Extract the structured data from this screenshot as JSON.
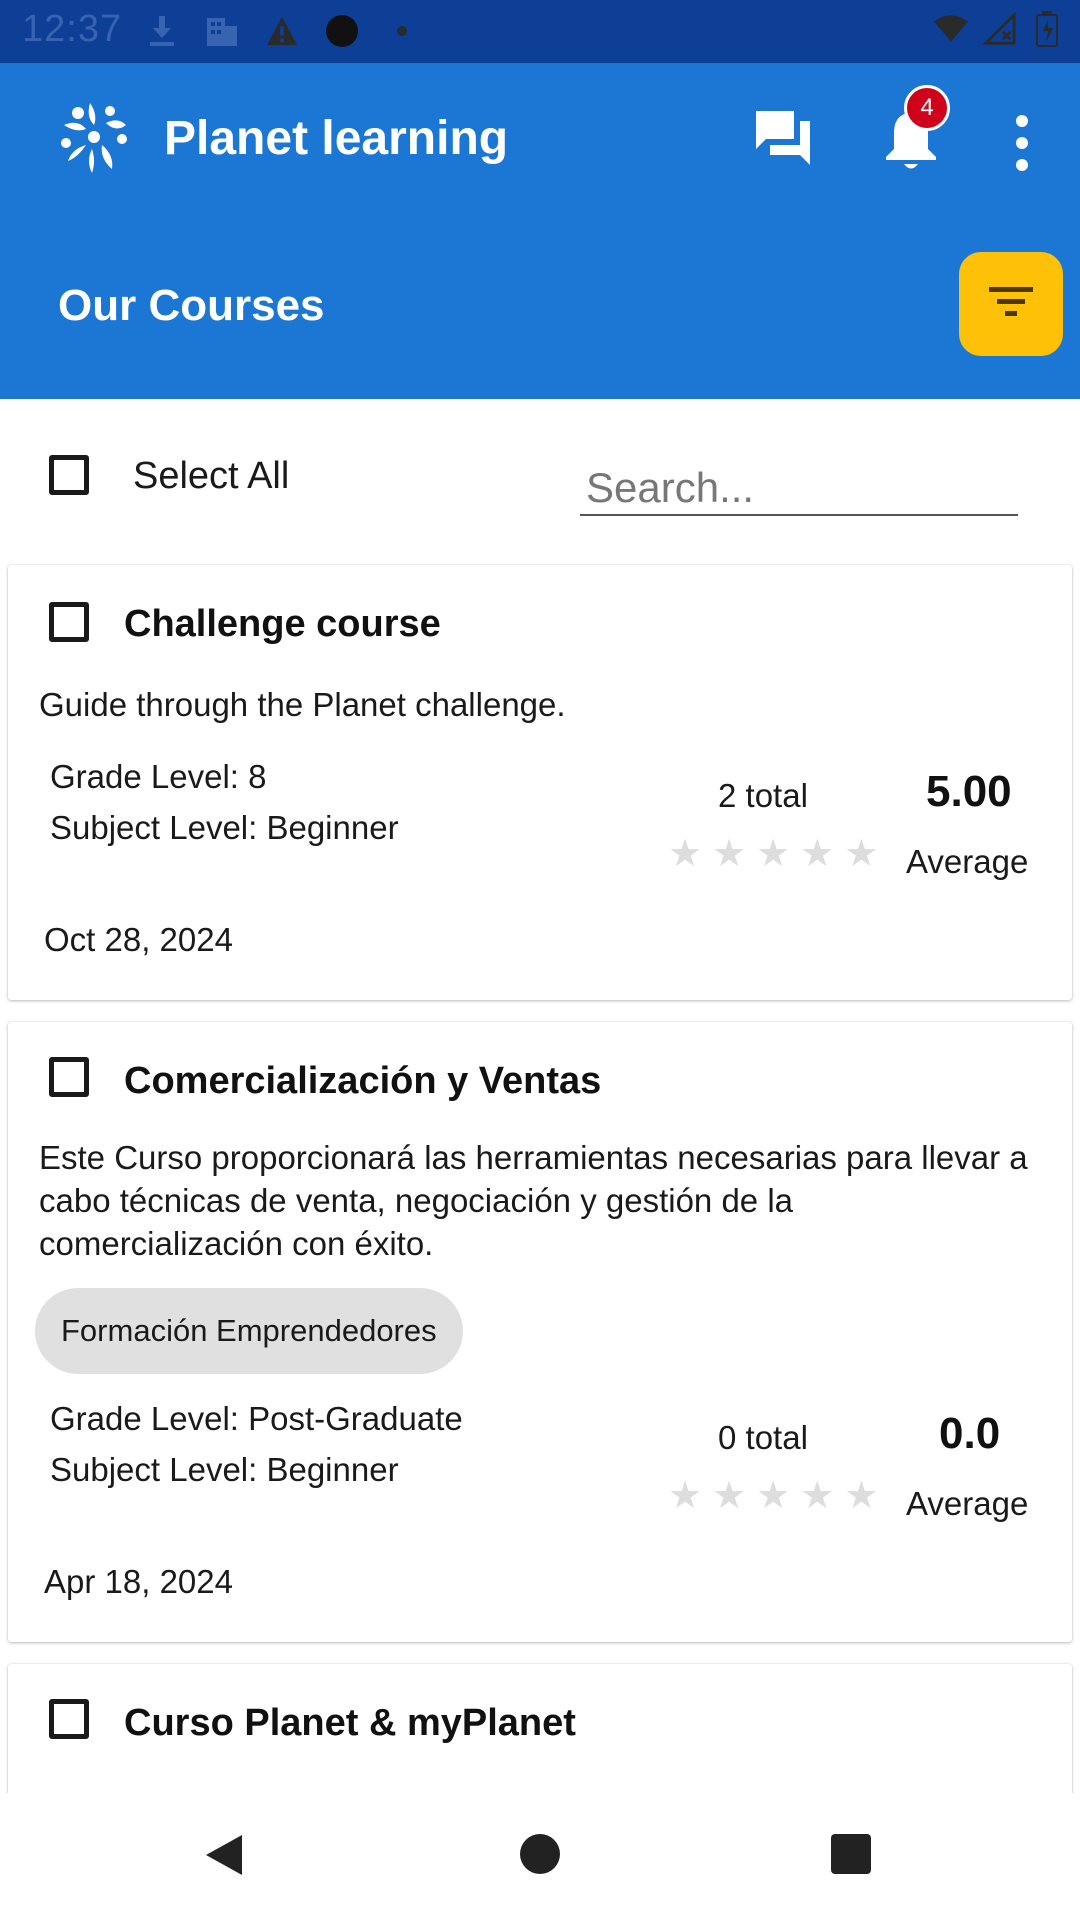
{
  "status_bar": {
    "time": "12:37",
    "left_icons": [
      "download-icon",
      "building-icon",
      "warning-icon",
      "circle-icon",
      "dot-icon"
    ],
    "right_icons": [
      "wifi-icon",
      "signal-icon",
      "battery-icon"
    ]
  },
  "app_bar": {
    "title": "Planet learning",
    "notification_count": "4",
    "section_title": "Our Courses",
    "colors": {
      "primary": "#1b77d3",
      "status": "#0d3f96",
      "accent": "#ffc107",
      "badge": "#d0021b"
    }
  },
  "controls": {
    "select_all_label": "Select All",
    "search_placeholder": "Search..."
  },
  "courses": [
    {
      "title": "Challenge course",
      "description": "Guide through the Planet challenge.",
      "tag": "",
      "grade_level": "Grade Level: 8",
      "subject_level": "Subject Level: Beginner",
      "total": "2 total",
      "average": "5.00",
      "average_label": "Average",
      "rating": 0,
      "date": "Oct 28, 2024"
    },
    {
      "title": "Comercialización y Ventas",
      "description": "Este Curso proporcionará las herramientas necesarias para llevar a cabo técnicas de venta, negociación y gestión de la comercialización con éxito.",
      "tag": "Formación Emprendedores",
      "grade_level": "Grade Level: Post-Graduate",
      "subject_level": "Subject Level: Beginner",
      "total": "0 total",
      "average": "0.0",
      "average_label": "Average",
      "rating": 0,
      "date": "Apr 18, 2024"
    },
    {
      "title": "Curso Planet & myPlanet"
    }
  ],
  "nav": {
    "icons": [
      "back-icon",
      "home-icon",
      "recents-icon"
    ]
  }
}
